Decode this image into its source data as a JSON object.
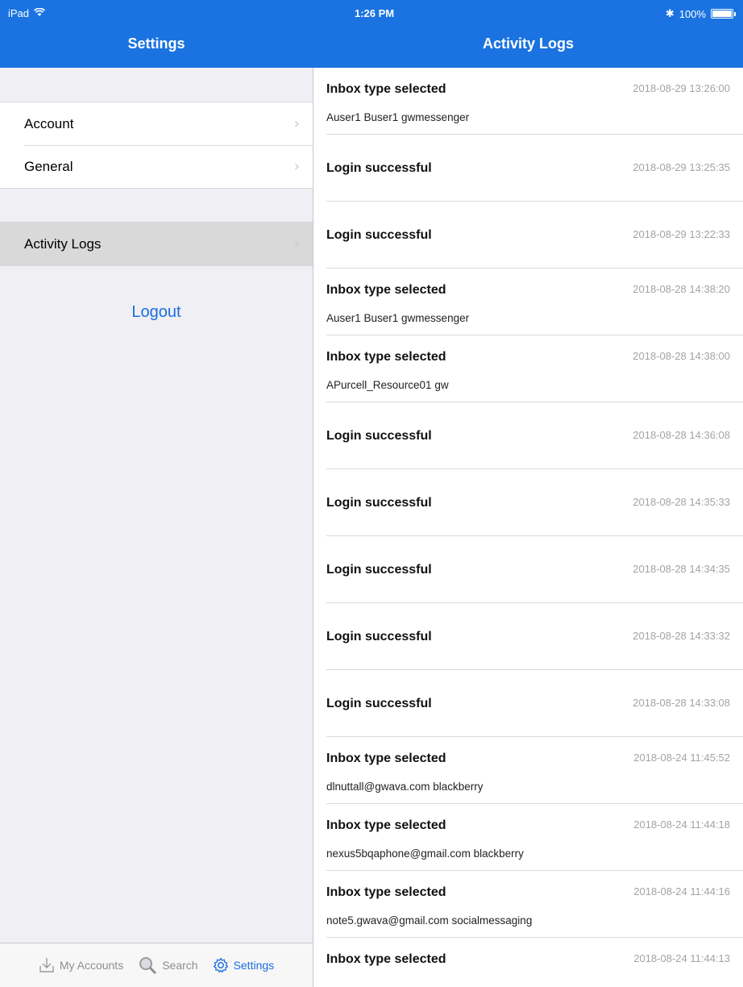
{
  "status_bar": {
    "device": "iPad",
    "time": "1:26 PM",
    "battery": "100%"
  },
  "master": {
    "title": "Settings",
    "groups": [
      {
        "items": [
          {
            "label": "Account"
          },
          {
            "label": "General"
          }
        ]
      },
      {
        "items": [
          {
            "label": "Activity Logs",
            "selected": true
          }
        ]
      }
    ],
    "logout_label": "Logout"
  },
  "tabbar": {
    "tabs": [
      {
        "label": "My Accounts",
        "icon": "download-icon",
        "active": false
      },
      {
        "label": "Search",
        "icon": "search-icon",
        "active": false
      },
      {
        "label": "Settings",
        "icon": "gear-icon",
        "active": true
      }
    ]
  },
  "detail": {
    "title": "Activity Logs",
    "logs": [
      {
        "title": "Inbox type selected",
        "time": "2018-08-29 13:26:00",
        "subtitle": "Auser1 Buser1 gwmessenger"
      },
      {
        "title": "Login successful",
        "time": "2018-08-29 13:25:35",
        "subtitle": ""
      },
      {
        "title": "Login successful",
        "time": "2018-08-29 13:22:33",
        "subtitle": ""
      },
      {
        "title": "Inbox type selected",
        "time": "2018-08-28 14:38:20",
        "subtitle": "Auser1 Buser1 gwmessenger"
      },
      {
        "title": "Inbox type selected",
        "time": "2018-08-28 14:38:00",
        "subtitle": "APurcell_Resource01 gw"
      },
      {
        "title": "Login successful",
        "time": "2018-08-28 14:36:08",
        "subtitle": ""
      },
      {
        "title": "Login successful",
        "time": "2018-08-28 14:35:33",
        "subtitle": ""
      },
      {
        "title": "Login successful",
        "time": "2018-08-28 14:34:35",
        "subtitle": ""
      },
      {
        "title": "Login successful",
        "time": "2018-08-28 14:33:32",
        "subtitle": ""
      },
      {
        "title": "Login successful",
        "time": "2018-08-28 14:33:08",
        "subtitle": ""
      },
      {
        "title": "Inbox type selected",
        "time": "2018-08-24 11:45:52",
        "subtitle": "dlnuttall@gwava.com blackberry"
      },
      {
        "title": "Inbox type selected",
        "time": "2018-08-24 11:44:18",
        "subtitle": "nexus5bqaphone@gmail.com blackberry"
      },
      {
        "title": "Inbox type selected",
        "time": "2018-08-24 11:44:16",
        "subtitle": "note5.gwava@gmail.com socialmessaging"
      },
      {
        "title": "Inbox type selected",
        "time": "2018-08-24 11:44:13",
        "subtitle": ""
      }
    ]
  },
  "colors": {
    "accent": "#1a73e0",
    "link": "#1a6ee0",
    "timestamp": "#a3a3a8",
    "selected_row": "#d9d9d9"
  }
}
